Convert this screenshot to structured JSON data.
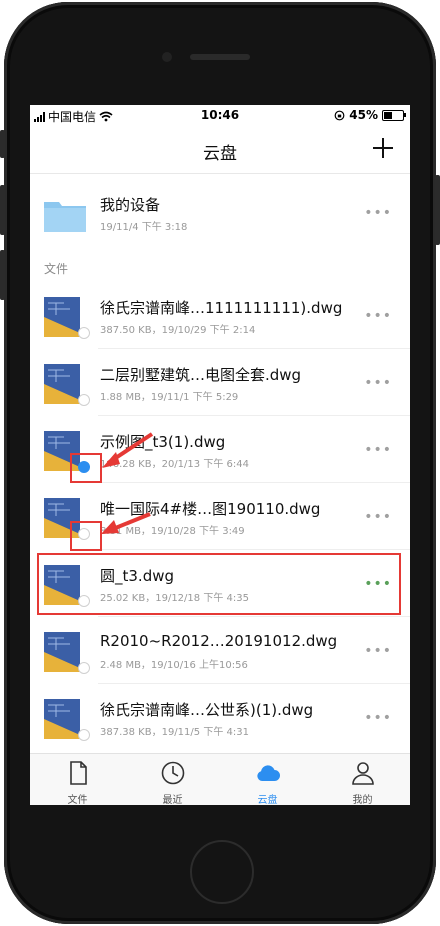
{
  "status_bar": {
    "carrier": "中国电信",
    "time": "10:46",
    "battery_text": "45%",
    "battery_level": 0.45
  },
  "nav": {
    "title": "云盘",
    "add_icon": "plus-icon"
  },
  "device": {
    "name": "我的设备",
    "meta": "19/11/4 下午 3:18",
    "icon": "folder-icon"
  },
  "section_label": "文件",
  "files": [
    {
      "name": "徐氏宗谱南峰…1111111111).dwg",
      "meta": "387.50 KB，19/10/29 下午 2:14",
      "cloud": "gray"
    },
    {
      "name": "二层别墅建筑…电图全套.dwg",
      "meta": "1.88 MB，19/11/1 下午 5:29",
      "cloud": "gray"
    },
    {
      "name": "示例图_t3(1).dwg",
      "meta": "146.28 KB，20/1/13 下午 6:44",
      "cloud": "blue"
    },
    {
      "name": "唯一国际4#楼…图190110.dwg",
      "meta": "8.81 MB，19/10/28 下午 3:49",
      "cloud": "gray"
    },
    {
      "name": "圆_t3.dwg",
      "meta": "25.02 KB，19/12/18 下午 4:35",
      "cloud": "gray",
      "highlighted": true
    },
    {
      "name": "R2010~R2012…20191012.dwg",
      "meta": "2.48 MB，19/10/16 上午10:56",
      "cloud": "gray"
    },
    {
      "name": "徐氏宗谱南峰…公世系)(1).dwg",
      "meta": "387.38 KB，19/11/5 下午 4:31",
      "cloud": "gray"
    }
  ],
  "more_label": "•••",
  "tabs": [
    {
      "label": "文件",
      "icon": "file-icon",
      "active": false
    },
    {
      "label": "最近",
      "icon": "clock-icon",
      "active": false
    },
    {
      "label": "云盘",
      "icon": "cloud-icon",
      "active": true
    },
    {
      "label": "我的",
      "icon": "person-icon",
      "active": false
    }
  ],
  "colors": {
    "accent": "#2c8ef0",
    "annotation": "#e53935",
    "dwg_blue": "#3b5fa6",
    "dwg_yellow": "#e7b23a",
    "folder": "#8cc7ef"
  }
}
